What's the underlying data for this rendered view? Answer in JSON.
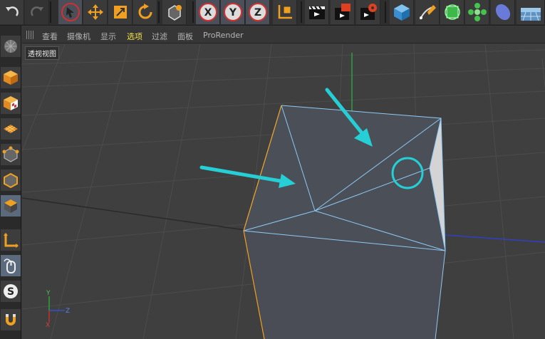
{
  "viewport_menu": {
    "items": [
      "查看",
      "摄像机",
      "显示",
      "选项",
      "过滤",
      "面板",
      "ProRender"
    ],
    "active": "选项"
  },
  "viewport": {
    "label": "透视视图",
    "axis_gizmo": {
      "y": "Y",
      "z": "Z",
      "x": "X"
    }
  },
  "colors": {
    "accent_selected_menu": "#f3e04a",
    "annotation_cyan": "#26cfd6",
    "mesh_edge": "#8ec9f5",
    "selected_edge_orange": "#f0a020"
  },
  "toolbar_icons": [
    "undo-icon",
    "redo-icon",
    "select-icon",
    "move-icon",
    "scale-icon",
    "rotate-icon",
    "live-select-icon",
    "x-axis-lock-icon",
    "y-axis-lock-icon",
    "z-axis-lock-icon",
    "coordinate-system-icon",
    "render-view-icon",
    "render-picture-viewer-icon",
    "render-settings-icon",
    "cube-primitive-icon",
    "pen-spline-icon",
    "subdivision-icon",
    "array-icon",
    "deformer-icon",
    "floor-environment-icon"
  ],
  "left_toolbar_icons": [
    "make-editable-icon",
    "model-mode-icon",
    "texture-mode-icon",
    "workplane-icon",
    "points-mode-icon",
    "edges-mode-icon",
    "polygons-mode-icon",
    "axis-mode-icon",
    "tweak-mode-icon",
    "snap-icon",
    "magnet-icon"
  ]
}
